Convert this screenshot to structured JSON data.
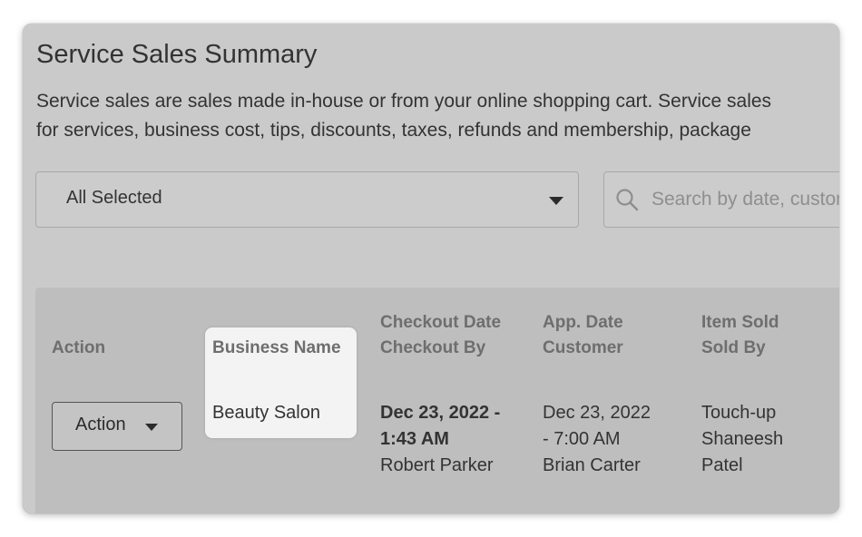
{
  "page": {
    "title": "Service Sales Summary",
    "description_lines": [
      "Service sales are sales made in-house or from your online shopping cart. Service sales",
      "for services, business cost, tips, discounts, taxes, refunds and membership, package"
    ]
  },
  "filters": {
    "location_select": {
      "value": "All Selected"
    },
    "search": {
      "placeholder": "Search by date, customer"
    }
  },
  "table": {
    "headers": {
      "action": "Action",
      "business_name": "Business Name",
      "checkout_date": "Checkout Date",
      "checkout_by": "Checkout By",
      "app_date": "App. Date",
      "customer": "Customer",
      "item_sold": "Item Sold",
      "sold_by": "Sold By"
    },
    "rows": [
      {
        "action_label": "Action",
        "business_name": "Beauty Salon",
        "checkout_date_l1": "Dec 23, 2022 -",
        "checkout_date_l2": "1:43 AM",
        "checkout_by": "Robert Parker",
        "app_date_l1": "Dec 23, 2022",
        "app_date_l2": "- 7:00 AM",
        "customer": "Brian Carter",
        "item_sold": "Touch-up",
        "sold_by_l1": "Shaneesh",
        "sold_by_l2": "Patel"
      }
    ]
  },
  "icons": {
    "search": "search-icon",
    "dropdown": "chevron-down-icon"
  },
  "colors": {
    "panel_bg": "#cacaca",
    "table_bg": "#bebebe",
    "highlight_bg": "#f3f3f3",
    "text": "#333333",
    "header_text": "#6e6e6e"
  }
}
